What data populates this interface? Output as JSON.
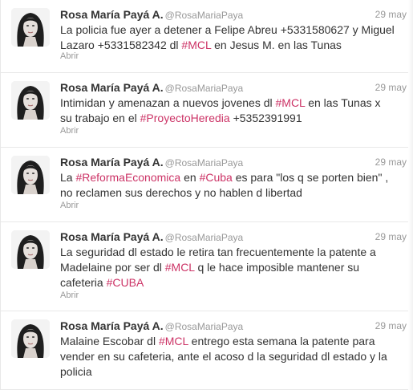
{
  "theme": {
    "text": "#333333",
    "muted": "#999999",
    "link": "#cc3366",
    "divider": "#e8e8e8"
  },
  "tweets": [
    {
      "author": "Rosa María Payá A.",
      "handle": "@RosaMariaPaya",
      "date": "29 may",
      "expand": "Abrir",
      "segments": [
        {
          "text": "La policia fue ayer a detener a Felipe Abreu +5331580627 y Miguel Lazaro +5331582342 dl "
        },
        {
          "text": "#MCL",
          "hashtag": true
        },
        {
          "text": " en Jesus M. en las Tunas"
        }
      ]
    },
    {
      "author": "Rosa María Payá A.",
      "handle": "@RosaMariaPaya",
      "date": "29 may",
      "expand": "Abrir",
      "segments": [
        {
          "text": "Intimidan y amenazan a nuevos jovenes dl "
        },
        {
          "text": "#MCL",
          "hashtag": true
        },
        {
          "text": " en las Tunas x su trabajo en el "
        },
        {
          "text": "#ProyectoHeredia",
          "hashtag": true
        },
        {
          "text": " +5352391991"
        }
      ]
    },
    {
      "author": "Rosa María Payá A.",
      "handle": "@RosaMariaPaya",
      "date": "29 may",
      "expand": "Abrir",
      "segments": [
        {
          "text": "La "
        },
        {
          "text": "#ReformaEconomica",
          "hashtag": true
        },
        {
          "text": " en "
        },
        {
          "text": "#Cuba",
          "hashtag": true
        },
        {
          "text": " es para \"los q se porten bien\" , no reclamen sus derechos y no hablen d libertad"
        }
      ]
    },
    {
      "author": "Rosa María Payá A.",
      "handle": "@RosaMariaPaya",
      "date": "29 may",
      "expand": "Abrir",
      "segments": [
        {
          "text": "La seguridad dl estado le retira tan frecuentemente la patente a Madelaine por ser dl "
        },
        {
          "text": "#MCL",
          "hashtag": true
        },
        {
          "text": " q le hace imposible mantener su cafeteria "
        },
        {
          "text": "#CUBA",
          "hashtag": true
        }
      ]
    },
    {
      "author": "Rosa María Payá A.",
      "handle": "@RosaMariaPaya",
      "date": "29 may",
      "expand": "",
      "segments": [
        {
          "text": "Malaine Escobar dl "
        },
        {
          "text": "#MCL",
          "hashtag": true
        },
        {
          "text": " entrego esta semana la patente para vender en su cafeteria, ante el acoso d la seguridad dl estado y la policia"
        }
      ]
    }
  ]
}
